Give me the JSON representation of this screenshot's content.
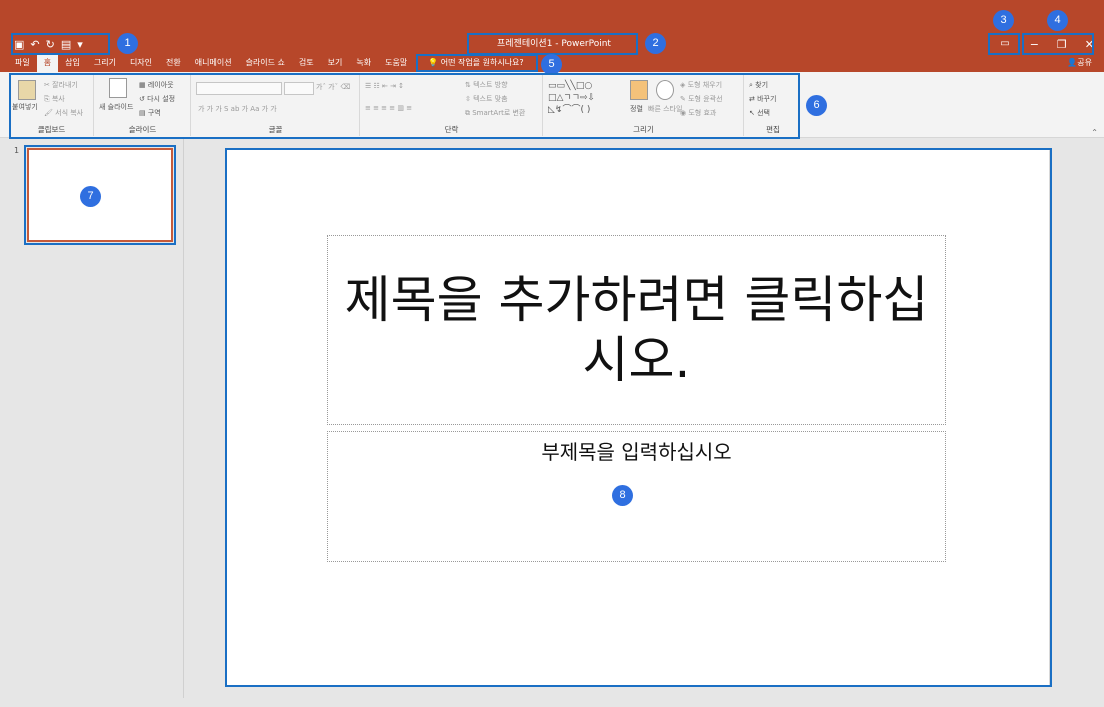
{
  "window": {
    "title": "프레젠테이션1 - PowerPoint",
    "share": "공유",
    "qat": [
      "save-icon",
      "undo-icon",
      "redo-icon",
      "present-icon",
      "customize-icon"
    ],
    "controls": [
      "minimize-icon",
      "restore-icon",
      "close-icon"
    ]
  },
  "tabs": [
    "파일",
    "홈",
    "삽입",
    "그리기",
    "디자인",
    "전환",
    "애니메이션",
    "슬라이드 쇼",
    "검토",
    "보기",
    "녹화",
    "도움말"
  ],
  "active_tab": "홈",
  "tellme": {
    "placeholder": "어떤 작업을 원하시나요?"
  },
  "ribbon": {
    "clipboard": {
      "label": "클립보드",
      "paste": "붙여넣기",
      "cut": "잘라내기",
      "copy": "복사",
      "format_painter": "서식 복사"
    },
    "slides": {
      "label": "슬라이드",
      "new_slide": "새 슬라이드",
      "layout": "레이아웃",
      "reset": "다시 설정",
      "section": "구역"
    },
    "font": {
      "label": "글꼴"
    },
    "paragraph": {
      "label": "단락",
      "text_direction": "텍스트 방향",
      "align_text": "텍스트 맞춤",
      "smartart": "SmartArt로 변환"
    },
    "drawing": {
      "label": "그리기",
      "arrange": "정렬",
      "quick_styles": "빠른 스타일",
      "fill": "도형 채우기",
      "outline": "도형 윤곽선",
      "effects": "도형 효과"
    },
    "editing": {
      "label": "편집",
      "find": "찾기",
      "replace": "바꾸기",
      "select": "선택"
    }
  },
  "thumbnails": {
    "number": "1"
  },
  "slide": {
    "title_placeholder": "제목을 추가하려면 클릭하십시오.",
    "subtitle_placeholder": "부제목을 입력하십시오"
  },
  "annotations": [
    "1",
    "2",
    "3",
    "4",
    "5",
    "6",
    "7",
    "8"
  ]
}
